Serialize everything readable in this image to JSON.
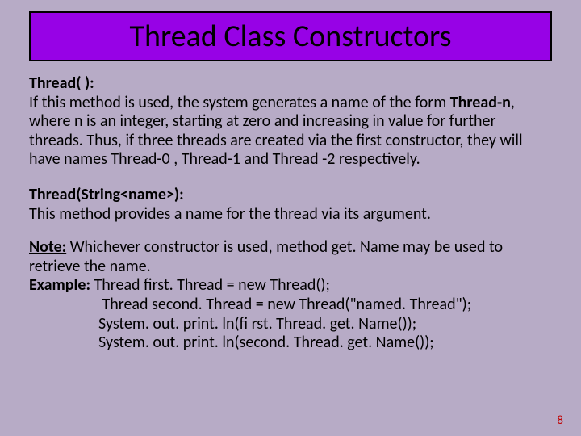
{
  "title": "Thread Class Constructors",
  "block1": {
    "heading": "Thread( ):",
    "text_part1": "If this method is used, the system generates a name of the form ",
    "bold_inline": "Thread-n",
    "text_part2": ", where n is an integer, starting at zero and increasing in value for further threads. Thus, if three threads are created via the first constructor, they will have names Thread-0 , Thread-1 and Thread -2 respectively."
  },
  "block2": {
    "heading": "Thread(String<name>):",
    "text": "This method provides a name for the thread via its argument."
  },
  "block3": {
    "note_label": "Note:",
    "note_text": " Whichever constructor is used, method get. Name may be used to retrieve the name.",
    "example_label": "Example:",
    "example_first": "  Thread first. Thread = new Thread();",
    "code2": " Thread second. Thread = new Thread(\"named. Thread\");",
    "code3": "System. out. print. ln(fi rst. Thread. get. Name());",
    "code4": "System. out. print. ln(second. Thread. get. Name());"
  },
  "page_number": "8"
}
